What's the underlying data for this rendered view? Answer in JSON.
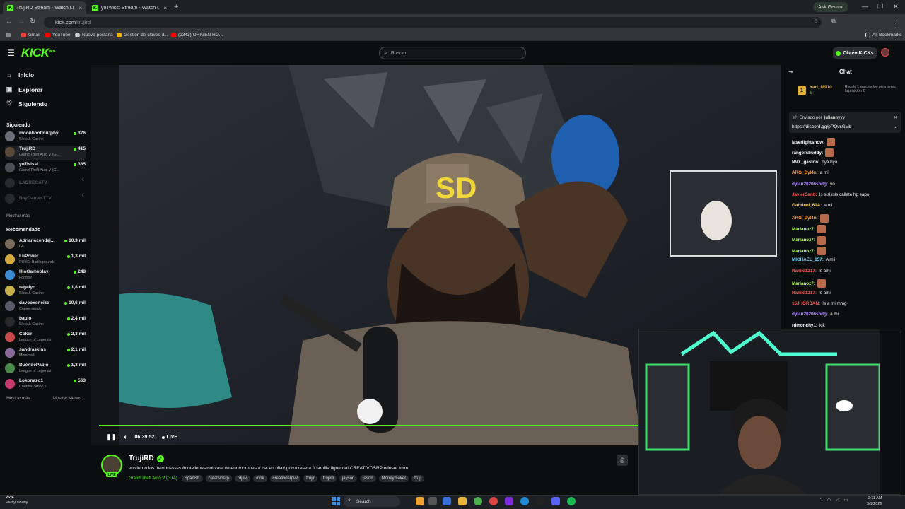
{
  "browser": {
    "tabs": [
      {
        "title": "TrujiRD Stream - Watch Live",
        "active": true
      },
      {
        "title": "yoTwisst Stream - Watch Live o",
        "active": false
      }
    ],
    "gemini_label": "Ask Gemini",
    "url_host": "kick.com",
    "url_path": "/trujird",
    "bookmarks": [
      "Gmail",
      "YouTube",
      "Nueva pestaña",
      "Gestión de claves d...",
      "(2343) ORIGEN HO..."
    ],
    "all_bookmarks": "All Bookmarks"
  },
  "header": {
    "logo": "KICK",
    "logo_sup": "BETA",
    "search_placeholder": "Buscar",
    "kicks_button": "Obtén KICKs"
  },
  "sidebar": {
    "nav": [
      {
        "label": "Inicio",
        "icon": "home-icon"
      },
      {
        "label": "Explorar",
        "icon": "compass-icon"
      },
      {
        "label": "Siguiendo",
        "icon": "heart-icon"
      }
    ],
    "following_heading": "Siguiendo",
    "following": [
      {
        "name": "moonbootmurphy",
        "category": "Slots & Casino",
        "viewers": "376",
        "color": "#6a6f7a"
      },
      {
        "name": "TrujiRD",
        "category": "Grand Theft Auto V (G...",
        "viewers": "415",
        "color": "#5b4a3a"
      },
      {
        "name": "yoTwisst",
        "category": "Grand Theft Auto V (G...",
        "viewers": "335",
        "color": "#4a4f55"
      },
      {
        "name": "LADRECATV",
        "category": "",
        "viewers": "",
        "color": "#555"
      },
      {
        "name": "DayGamesTTV",
        "category": "",
        "viewers": "",
        "color": "#555"
      }
    ],
    "show_more_1": "Mostrar más",
    "recommended_heading": "Recomendado",
    "recommended": [
      {
        "name": "Adrianozendej...",
        "category": "IRL",
        "viewers": "10,9 mil",
        "color": "#7a6a5a"
      },
      {
        "name": "LuPower",
        "category": "PUBG: Battlegrounds",
        "viewers": "1,3 mil",
        "color": "#d4a83a"
      },
      {
        "name": "HloGameplay",
        "category": "Fortnite",
        "viewers": "248",
        "color": "#3a8ad4"
      },
      {
        "name": "ragelyo",
        "category": "Slots & Casino",
        "viewers": "1,8 mil",
        "color": "#c8b04a"
      },
      {
        "name": "davooxeneize",
        "category": "Conversando",
        "viewers": "10,6 mil",
        "color": "#5a5a6a"
      },
      {
        "name": "baulo",
        "category": "Slots & Casino",
        "viewers": "2,4 mil",
        "color": "#2a2a2a"
      },
      {
        "name": "Coker",
        "category": "League of Legends",
        "viewers": "2,3 mil",
        "color": "#c84a4a"
      },
      {
        "name": "sandraskins",
        "category": "Minecraft",
        "viewers": "2,1 mil",
        "color": "#8a6a9a"
      },
      {
        "name": "DuendePablo",
        "category": "League of Legends",
        "viewers": "1,3 mil",
        "color": "#4a8a4a"
      },
      {
        "name": "Lokonazo1",
        "category": "Counter-Strike 2",
        "viewers": "563",
        "color": "#c83a6a"
      }
    ],
    "show_more_2": "Mostrar más",
    "show_less": "Mostrar Menos"
  },
  "player": {
    "elapsed": "06:39:52",
    "live_label": "LIVE"
  },
  "stream": {
    "streamer": "TrujiRD",
    "live_badge": "LIVE",
    "title": "volvieron los demonsssss #notellenesmotivate #menornorobes // cai en oila// gorra reseta // familia figueroa! CREATIVOSRP edesur tmm",
    "category": "Grand Theft Auto V (GTA)",
    "tags": [
      "Spanish",
      "creativosrp",
      "rdjavi",
      "mnk",
      "creativosrpv2",
      "trujir",
      "trujird",
      "jayson",
      "jason",
      "Moneymaker",
      "truji"
    ]
  },
  "chat": {
    "heading": "Chat",
    "pinned": {
      "user": "Yari_M910",
      "badge_num": "5",
      "message": "Regala 1 suscripción para tomar la posición 2",
      "rank": "1"
    },
    "sent_by_label": "Enviado por",
    "sent_by_user": "juliannyyy",
    "sent_link": "https://discord.gg/pPQvsGVb",
    "messages": [
      {
        "user": "laserlightshow:",
        "text": "",
        "color": "#ffffff",
        "emote": true
      },
      {
        "user": "rangersbuddy:",
        "text": "",
        "color": "#ffffff",
        "emote": true
      },
      {
        "user": "NVX_gaston:",
        "text": "bya bya",
        "color": "#ffffff",
        "emote": false
      },
      {
        "user": "ARG_Dyl4n:",
        "text": "a mi",
        "color": "#ff9a2a",
        "emote": false
      },
      {
        "user": "dylan20206shdg:",
        "text": "yo",
        "color": "#b58cff",
        "emote": false
      },
      {
        "user": "JavierSanti:",
        "text": "Is slslssls cállate hp sapo",
        "color": "#ff5a5a",
        "emote": false
      },
      {
        "user": "Gabrieel_61A:",
        "text": "a mi",
        "color": "#ffd23a",
        "emote": false
      },
      {
        "user": "ARG_Dyl4n:",
        "text": "",
        "color": "#ff9a2a",
        "emote": true
      },
      {
        "user": "Marianoz7:",
        "text": "",
        "color": "#b8ff5a",
        "emote": true
      },
      {
        "user": "Marianoz7:",
        "text": "",
        "color": "#b8ff5a",
        "emote": true
      },
      {
        "user": "Marianoz7:",
        "text": "",
        "color": "#b8ff5a",
        "emote": true
      },
      {
        "user": "MICHAEL_157:",
        "text": "A mii",
        "color": "#7ad8ff",
        "emote": false
      },
      {
        "user": "Ranixl1217:",
        "text": "!s ami",
        "color": "#ff5a5a",
        "emote": false
      },
      {
        "user": "Marianoz7:",
        "text": "",
        "color": "#b8ff5a",
        "emote": true
      },
      {
        "user": "Ranixl1217:",
        "text": "!s ami",
        "color": "#ff5a5a",
        "emote": false
      },
      {
        "user": "15JHORDAN:",
        "text": "!s a mi mmg",
        "color": "#ff5a5a",
        "emote": false
      },
      {
        "user": "dylan20206shdg:",
        "text": "a mi",
        "color": "#b58cff",
        "emote": false
      },
      {
        "user": "rdmonchy1:",
        "text": "kik",
        "color": "#ffffff",
        "emote": false
      }
    ]
  },
  "taskbar": {
    "temp": "26°F",
    "weather": "Partly cloudy",
    "search": "Search",
    "time": "2:11 AM",
    "date": "3/1/2026"
  },
  "colors": {
    "accent": "#53fc18",
    "bg": "#0b0e0f"
  }
}
